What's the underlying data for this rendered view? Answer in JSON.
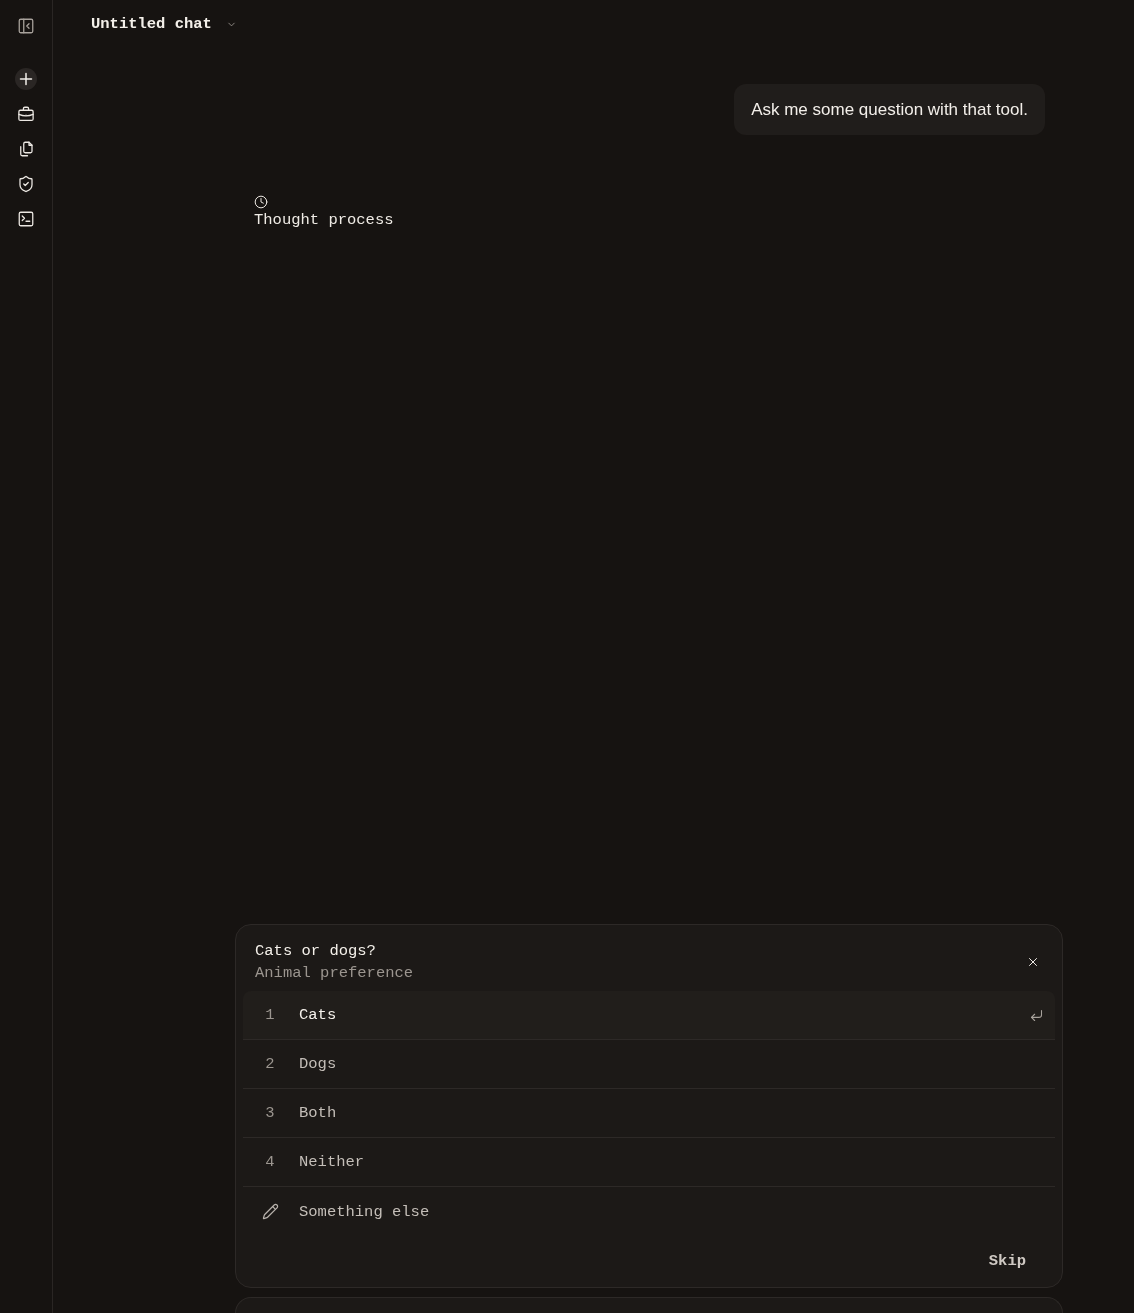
{
  "header": {
    "title": "Untitled chat"
  },
  "messages": [
    {
      "kind": "user",
      "text": "Ask me some question with that tool."
    },
    {
      "kind": "thought",
      "text": "Thought process"
    }
  ],
  "question": {
    "title": "Cats or dogs?",
    "subtitle": "Animal preference",
    "options": [
      {
        "kind": "choice",
        "number": "1",
        "label": "Cats",
        "selected": true
      },
      {
        "kind": "choice",
        "number": "2",
        "label": "Dogs",
        "selected": false
      },
      {
        "kind": "choice",
        "number": "3",
        "label": "Both",
        "selected": false
      },
      {
        "kind": "choice",
        "number": "4",
        "label": "Neither",
        "selected": false
      },
      {
        "kind": "custom",
        "label": "Something else",
        "selected": false
      }
    ],
    "skip": "Skip"
  }
}
